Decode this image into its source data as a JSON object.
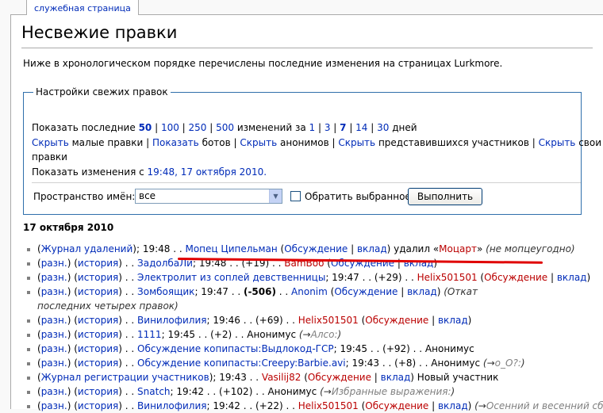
{
  "tab_label": "служебная страница",
  "page_title": "Несвежие правки",
  "intro": "Ниже в хронологическом порядке перечислены последние изменения на страницах Lurkmore.",
  "options": {
    "legend": "Настройки свежих правок",
    "show_last_label": "Показать последние",
    "limits": [
      "50",
      "100",
      "250",
      "500"
    ],
    "changes_for": "изменений за",
    "days_options": [
      "1",
      "3",
      "7",
      "14",
      "30"
    ],
    "days_word": "дней",
    "hide": "Скрыть",
    "show": "Показать",
    "minor_edits": "малые правки",
    "bots": "ботов",
    "anons": "анонимов",
    "logged_users": "представившихся участников",
    "own_edits_1": "свои",
    "own_edits_2": "правки",
    "since_label": "Показать изменения с",
    "since_value": "19:48, 17 октября 2010.",
    "namespace_label": "Пространство имён:",
    "namespace_value": "все",
    "invert_label": "Обратить выбранное",
    "go_button": "Выполнить"
  },
  "day_heading": "17 октября 2010",
  "labels": {
    "diff": "разн.",
    "hist": "история",
    "talk": "Обсуждение",
    "contribs": "вклад"
  },
  "entries": {
    "e0": {
      "log": "Журнал удалений",
      "time": "19:48",
      "user": "Мопец Ципельман",
      "action": "удалил «",
      "target": "Моцарт",
      "action_end": "»",
      "comment": "(не мопцеугодно)"
    },
    "e1": {
      "title": "ЗадолбаЛи",
      "time": "19:48",
      "delta": "(+19)",
      "user": "BamBoo"
    },
    "e2": {
      "title": "Электролит из соплей девственницы",
      "time": "19:47",
      "delta": "(+29)",
      "user": "Helix501501"
    },
    "e3": {
      "title": "Зомбоящик",
      "time": "19:47",
      "delta": "(-506)",
      "user": "Anonim",
      "comment": "(Откат последних четырех правок)"
    },
    "e4": {
      "title": "Винилофилия",
      "time": "19:46",
      "delta": "(+69)",
      "user": "Helix501501"
    },
    "e5": {
      "title": "1111",
      "time": "19:45",
      "delta": "(+2)",
      "user": "Анонимус",
      "comment_open": "(→",
      "comment_link": "Алсо:",
      "comment_close": ")"
    },
    "e6": {
      "title": "Обсуждение копипасты:Выдлокод-ГСР",
      "time": "19:45",
      "delta": "(+92)",
      "user": "Анонимус"
    },
    "e7": {
      "title": "Обсуждение копипасты:Creepy:Barbie.avi",
      "time": "19:43",
      "delta": "(+8)",
      "user": "Анонимус",
      "comment_open": "(→",
      "comment_link": "о_О?:",
      "comment_close": ")"
    },
    "e8": {
      "log": "Журнал регистрации участников",
      "time": "19:43",
      "user": "Vasilij82",
      "action": "Новый участник"
    },
    "e9": {
      "title": "Snatch",
      "time": "19:42",
      "delta": "(+102)",
      "user": "Анонимус",
      "comment_open": "(→",
      "comment_link": "Избранные выражения:",
      "comment_close": ")"
    },
    "e10": {
      "title": "Винилофилия",
      "time": "19:42",
      "delta": "(+22)",
      "user": "Helix501501",
      "comment_open": "(→",
      "comment_link": "Осенний и весенний сбор"
    }
  },
  "colors": {
    "link": "#002bb8",
    "new_link": "#ba0000",
    "fieldset_border": "#2f6fab",
    "annotation": "#e00000"
  }
}
